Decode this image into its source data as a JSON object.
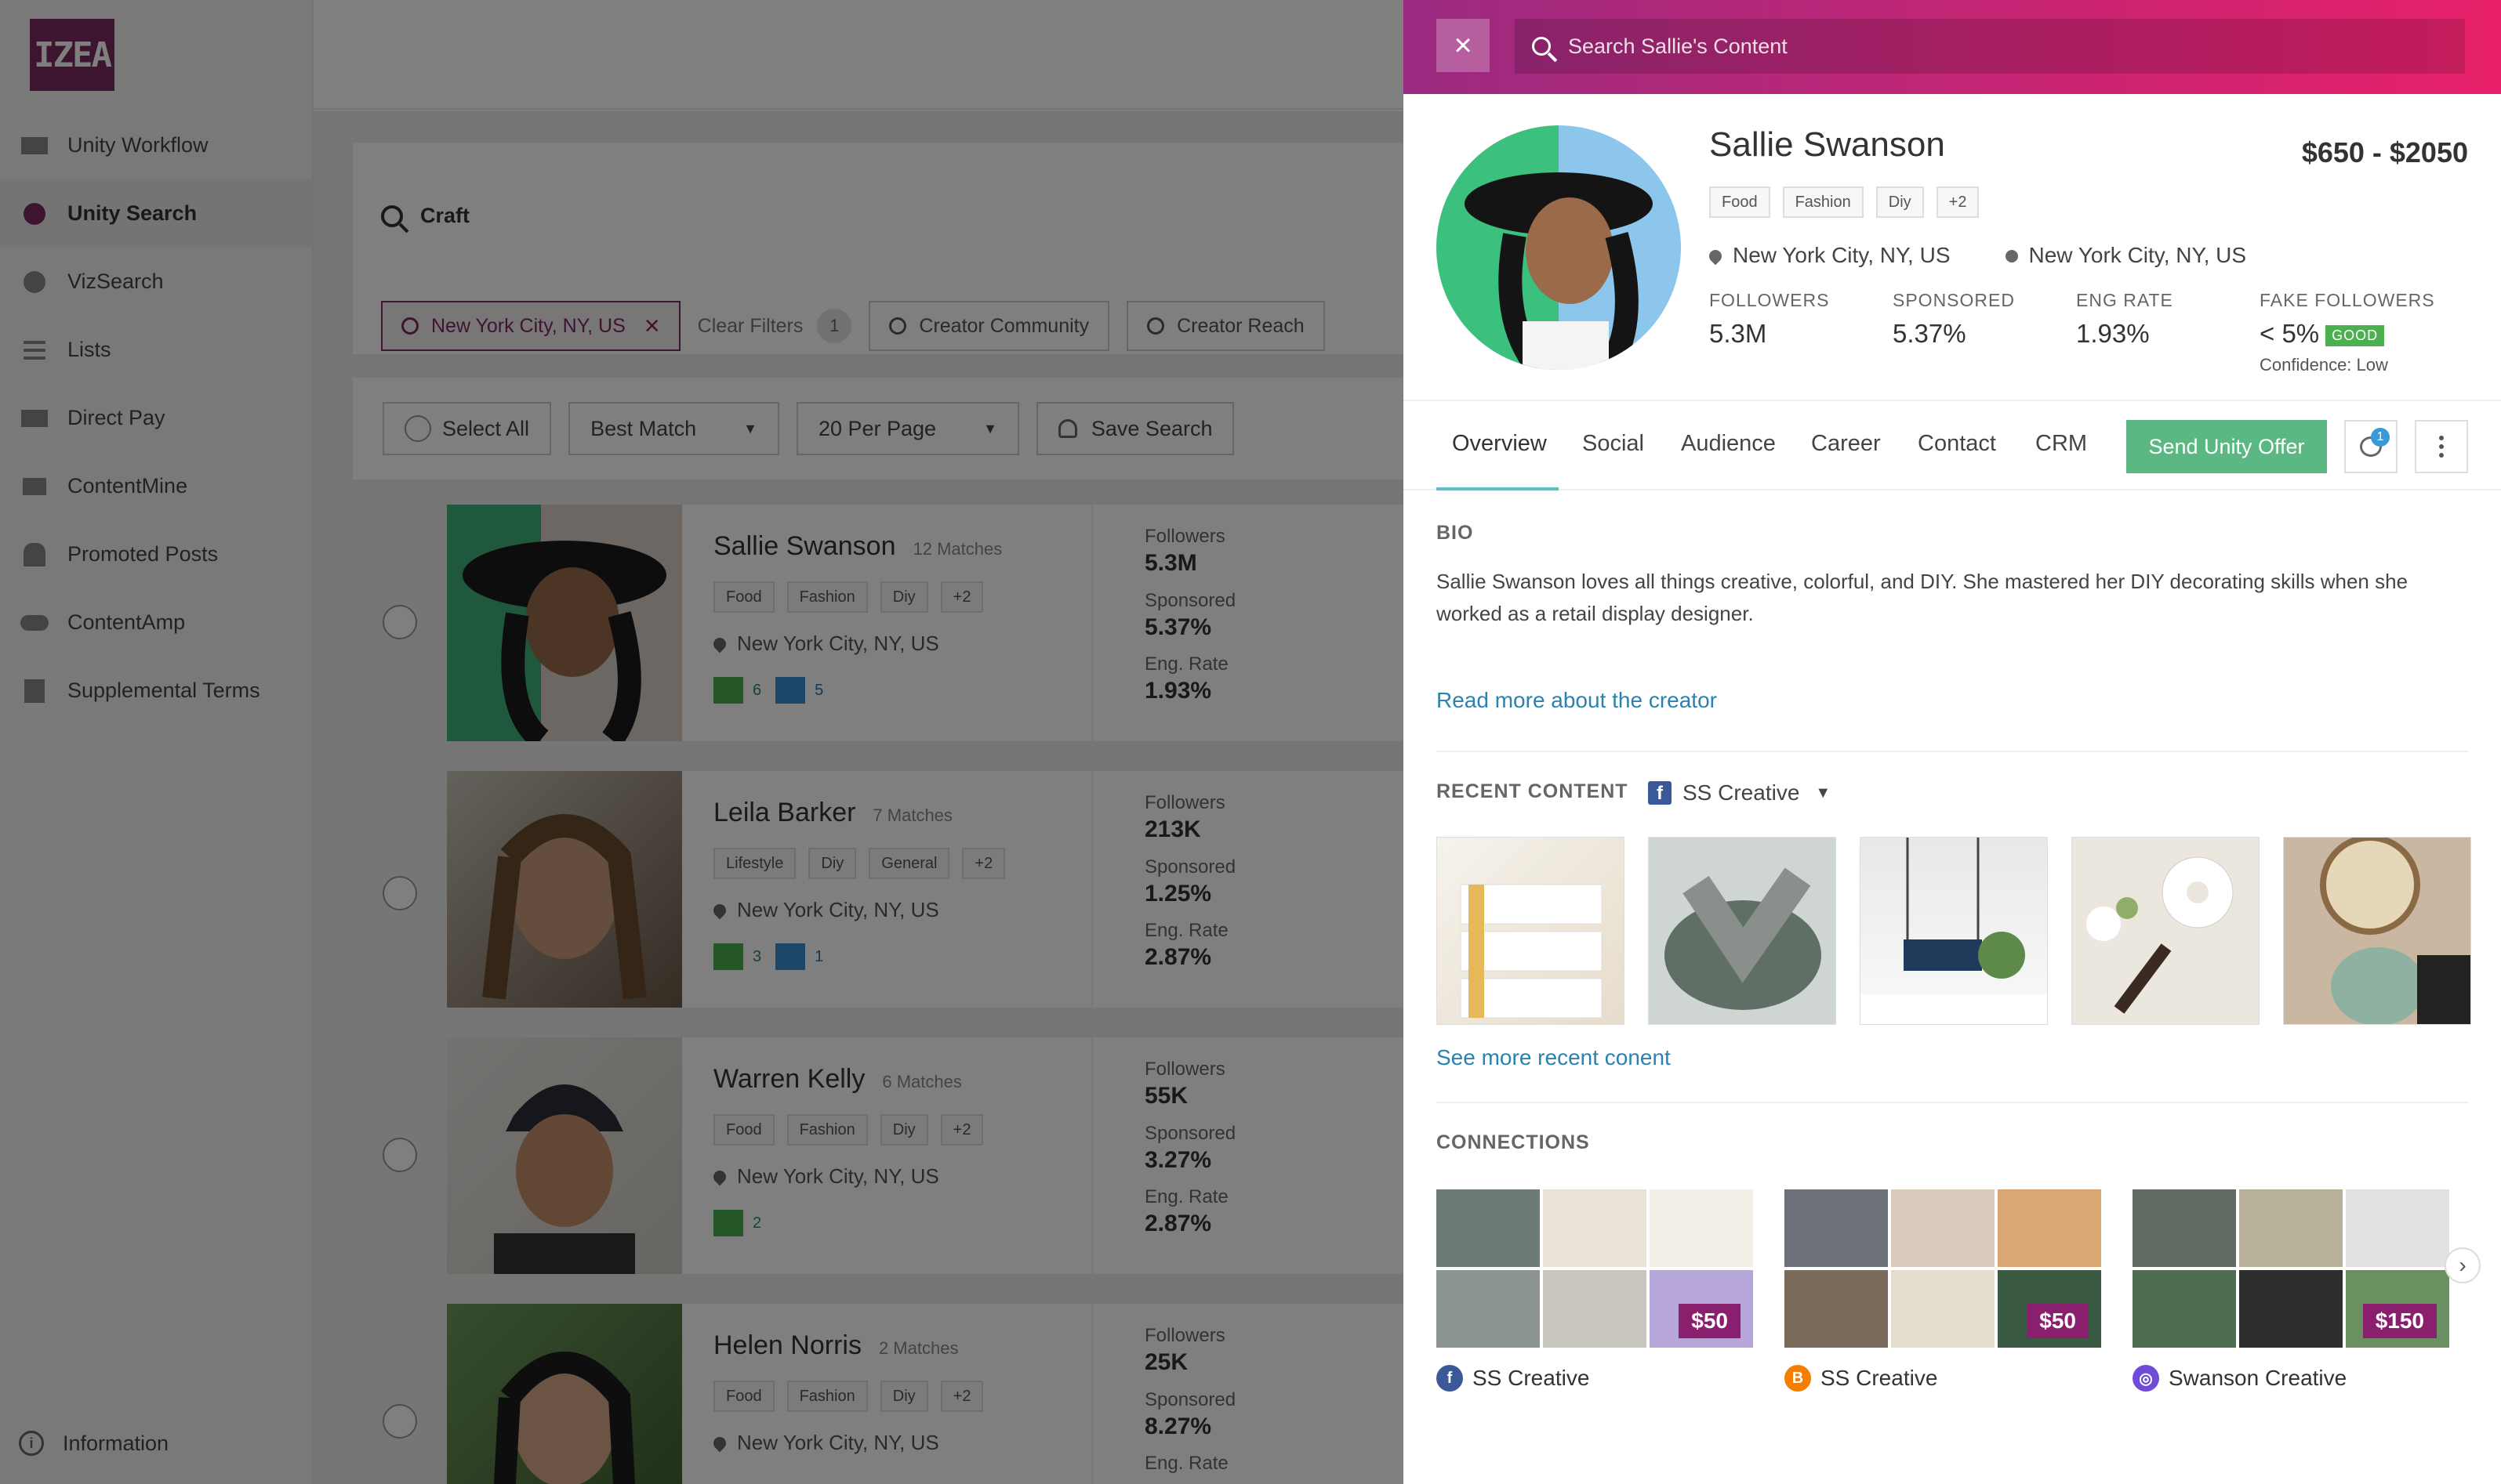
{
  "brand": {
    "logo_text": "IZEA",
    "accent": "#7a2a63",
    "panel_gradient": [
      "#9a2a80",
      "#e8216a"
    ]
  },
  "sidebar": {
    "items": [
      {
        "label": "Unity Workflow",
        "icon": "workflow-icon"
      },
      {
        "label": "Unity Search",
        "icon": "unity-search-icon"
      },
      {
        "label": "VizSearch",
        "icon": "vizsearch-icon"
      },
      {
        "label": "Lists",
        "icon": "list-icon"
      },
      {
        "label": "Direct Pay",
        "icon": "direct-pay-icon"
      },
      {
        "label": "ContentMine",
        "icon": "folder-icon"
      },
      {
        "label": "Promoted Posts",
        "icon": "promoted-icon"
      },
      {
        "label": "ContentAmp",
        "icon": "contentamp-icon"
      },
      {
        "label": "Supplemental Terms",
        "icon": "document-icon"
      }
    ],
    "info_label": "Information"
  },
  "search": {
    "query": "Craft",
    "location_filter": "New York City, NY, US",
    "clear_filters": "Clear Filters",
    "clear_count": "1",
    "creator_community": "Creator Community",
    "creator_reach": "Creator Reach"
  },
  "toolbar": {
    "select_all": "Select All",
    "sort": "Best Match",
    "per_page": "20 Per Page",
    "save_search": "Save Search"
  },
  "results": [
    {
      "name": "Sallie Swanson",
      "matches": "12 Matches",
      "tags": [
        "Food",
        "Fashion",
        "Diy",
        "+2"
      ],
      "location": "New York City, NY, US",
      "badges": [
        "6",
        "5"
      ],
      "followers": "5.3M",
      "sponsored": "5.37%",
      "eng_rate": "1.93%"
    },
    {
      "name": "Leila Barker",
      "matches": "7 Matches",
      "tags": [
        "Lifestyle",
        "Diy",
        "General",
        "+2"
      ],
      "location": "New York City, NY, US",
      "badges": [
        "3",
        "1"
      ],
      "followers": "213K",
      "sponsored": "1.25%",
      "eng_rate": "2.87%"
    },
    {
      "name": "Warren Kelly",
      "matches": "6 Matches",
      "tags": [
        "Food",
        "Fashion",
        "Diy",
        "+2"
      ],
      "location": "New York City, NY, US",
      "badges": [
        "2"
      ],
      "followers": "55K",
      "sponsored": "3.27%",
      "eng_rate": "2.87%"
    },
    {
      "name": "Helen Norris",
      "matches": "2 Matches",
      "tags": [
        "Food",
        "Fashion",
        "Diy",
        "+2"
      ],
      "location": "New York City, NY, US",
      "badges": [],
      "followers": "25K",
      "sponsored": "8.27%",
      "eng_rate": ""
    }
  ],
  "stat_labels": {
    "followers": "Followers",
    "sponsored": "Sponsored",
    "eng_rate": "Eng. Rate"
  },
  "panel": {
    "search_placeholder": "Search Sallie's Content",
    "name": "Sallie Swanson",
    "price": "$650 - $2050",
    "tags": [
      "Food",
      "Fashion",
      "Diy",
      "+2"
    ],
    "location": "New York City, NY, US",
    "location2": "New York City, NY, US",
    "stats": {
      "followers_label": "FOLLOWERS",
      "followers": "5.3M",
      "sponsored_label": "SPONSORED",
      "sponsored": "5.37%",
      "eng_label": "ENG RATE",
      "eng": "1.93%",
      "fake_label": "FAKE FOLLOWERS",
      "fake": "< 5%",
      "fake_badge": "GOOD",
      "confidence_label": "Confidence:",
      "confidence": "Low"
    },
    "tabs": [
      "Overview",
      "Social",
      "Audience",
      "Career",
      "Contact",
      "CRM"
    ],
    "offer_button": "Send Unity Offer",
    "message_count": "1",
    "bio_heading": "BIO",
    "bio": "Sallie Swanson loves all things creative, colorful, and DIY.  She mastered her DIY decorating skills when she worked as a retail display designer.",
    "read_more": "Read more about the creator",
    "recent_heading": "RECENT CONTENT",
    "recent_account": "SS Creative",
    "see_more": "See more recent conent",
    "connections_heading": "CONNECTIONS",
    "connections": [
      {
        "name": "SS Creative",
        "price": "$50",
        "network": "facebook-icon",
        "color": "#3b5998"
      },
      {
        "name": "SS Creative",
        "price": "$50",
        "network": "blogger-icon",
        "color": "#f57d00"
      },
      {
        "name": "Swanson Creative",
        "price": "$150",
        "network": "instagram-icon",
        "color": "#6f4bd8"
      }
    ]
  }
}
